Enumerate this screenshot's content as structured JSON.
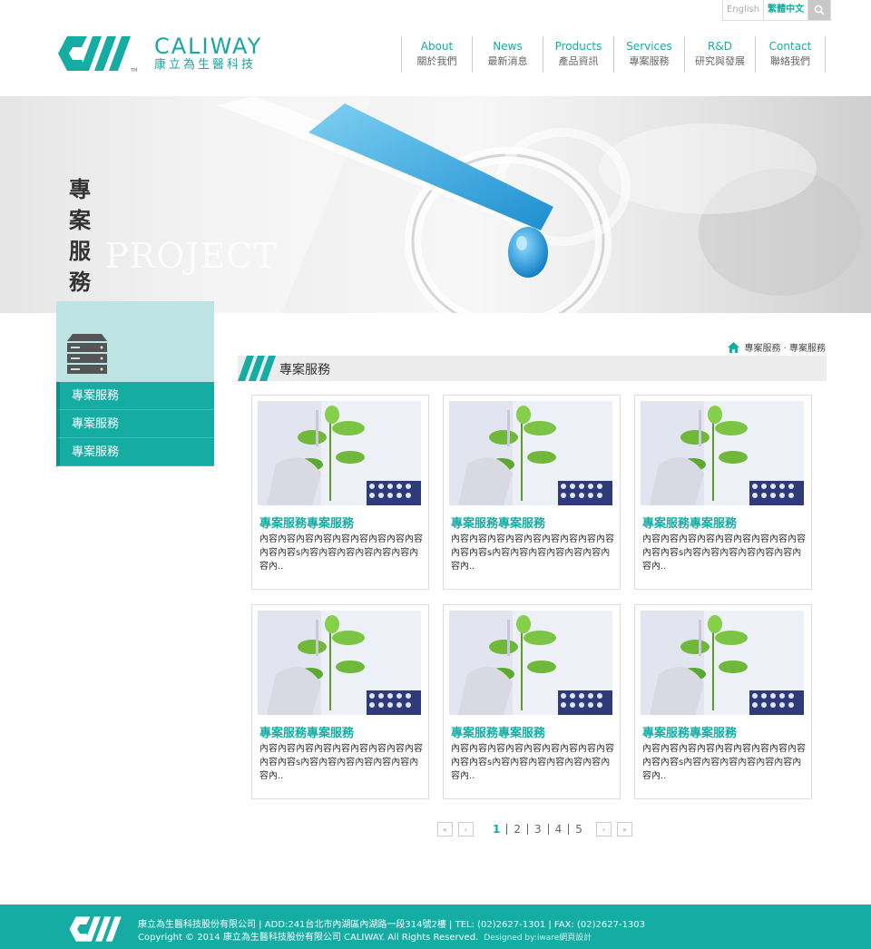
{
  "top": {
    "lang_en": "English",
    "lang_zh": "繁體中文"
  },
  "logo": {
    "en": "CALIWAY",
    "zh": "康立為生醫科技",
    "tm": "TM"
  },
  "nav": [
    {
      "en": "About",
      "zh": "關於我們"
    },
    {
      "en": "News",
      "zh": "最新消息"
    },
    {
      "en": "Products",
      "zh": "產品資訊"
    },
    {
      "en": "Services",
      "zh": "專案服務"
    },
    {
      "en": "R&D",
      "zh": "研究與發展"
    },
    {
      "en": "Contact",
      "zh": "聯絡我們"
    }
  ],
  "banner": {
    "title": "專案服務",
    "en": "PROJECT"
  },
  "sidebar": {
    "items": [
      "專案服務",
      "專案服務",
      "專案服務"
    ]
  },
  "breadcrumb": {
    "path": "專案服務 · 專案服務"
  },
  "section": {
    "title": "專案服務"
  },
  "cards": [
    {
      "title": "專案服務專案服務",
      "text": "內容內容內容內容內容內容內容內容內容內容內容s內容內容內容內容內容內容內容內.."
    },
    {
      "title": "專案服務專案服務",
      "text": "內容內容內容內容內容內容內容內容內容內容內容s內容內容內容內容內容內容內容內.."
    },
    {
      "title": "專案服務專案服務",
      "text": "內容內容內容內容內容內容內容內容內容內容內容s內容內容內容內容內容內容內容內.."
    },
    {
      "title": "專案服務專案服務",
      "text": "內容內容內容內容內容內容內容內容內容內容內容s內容內容內容內容內容內容內容內.."
    },
    {
      "title": "專案服務專案服務",
      "text": "內容內容內容內容內容內容內容內容內容內容內容s內容內容內容內容內容內容內容內.."
    },
    {
      "title": "專案服務專案服務",
      "text": "內容內容內容內容內容內容內容內容內容內容內容s內容內容內容內容內容內容內容內.."
    }
  ],
  "pager": {
    "pages": [
      "1",
      "2",
      "3",
      "4",
      "5"
    ],
    "current": "1"
  },
  "footer": {
    "line1": "康立為生醫科技股份有限公司 | ADD:241台北市內湖區內湖路一段314號2樓 | TEL: (02)2627-1301 | FAX: (02)2627-1303",
    "line2": "Copyright © 2014 康立為生醫科技股份有限公司 CALIWAY. All Rights Reserved.",
    "design": "Designed by:iware網頁設計"
  },
  "colors": {
    "accent": "#15aca4",
    "accent_light": "#bde3e2"
  }
}
